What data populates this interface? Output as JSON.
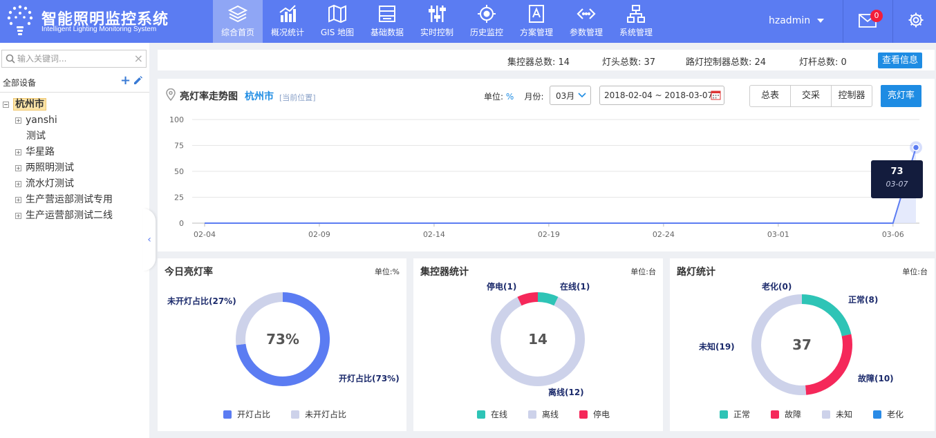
{
  "app": {
    "title": "智能照明监控系统",
    "subtitle": "Intelligent Lighting Monitoring System"
  },
  "nav": [
    {
      "label": "综合首页",
      "icon": "layers-icon",
      "active": true
    },
    {
      "label": "概况统计",
      "icon": "bar-chart-icon",
      "active": false
    },
    {
      "label": "GIS 地图",
      "icon": "map-icon",
      "active": false
    },
    {
      "label": "基础数据",
      "icon": "database-icon",
      "active": false
    },
    {
      "label": "实时控制",
      "icon": "sliders-icon",
      "active": false
    },
    {
      "label": "历史监控",
      "icon": "target-icon",
      "active": false
    },
    {
      "label": "方案管理",
      "icon": "plan-icon",
      "active": false
    },
    {
      "label": "参数管理",
      "icon": "code-icon",
      "active": false
    },
    {
      "label": "系统管理",
      "icon": "sitemap-icon",
      "active": false
    }
  ],
  "user": {
    "name": "hzadmin",
    "mail_count": "0"
  },
  "sidebar": {
    "search_placeholder": "输入关键词...",
    "clear_label": "×",
    "section_title": "全部设备",
    "add_label": "+",
    "tree_root": "杭州市",
    "tree_items": [
      {
        "label": "yanshi",
        "expandable": true
      },
      {
        "label": "测试",
        "expandable": false
      },
      {
        "label": "华星路",
        "expandable": true
      },
      {
        "label": "两照明测试",
        "expandable": true
      },
      {
        "label": "流水灯测试",
        "expandable": true
      },
      {
        "label": "生产营运部测试专用",
        "expandable": true
      },
      {
        "label": "生产运营部测试二线",
        "expandable": true
      }
    ],
    "collapse_label": "‹"
  },
  "stats": {
    "concentrator_total_label": "集控器总数:",
    "concentrator_total": "14",
    "lamp_total_label": "灯头总数:",
    "lamp_total": "37",
    "controller_total_label": "路灯控制器总数:",
    "controller_total": "24",
    "pole_total_label": "灯杆总数:",
    "pole_total": "0",
    "view_button": "查看信息"
  },
  "trend": {
    "title": "亮灯率走势图",
    "city": "杭州市",
    "location_hint": "[当前位置]",
    "unit_label": "单位:",
    "unit_value": "%",
    "month_label": "月份:",
    "month_value": "03月",
    "date_range": "2018-02-04 ~ 2018-03-07",
    "tabs": [
      "总表",
      "交采",
      "控制器",
      "亮灯率"
    ],
    "active_tab": "亮灯率",
    "tooltip_value": "73",
    "tooltip_date": "03-07"
  },
  "chart_data": {
    "type": "line",
    "ylim": [
      0,
      100
    ],
    "yticks": [
      0,
      25,
      50,
      75,
      100
    ],
    "xticks": [
      "02-04",
      "02-09",
      "02-14",
      "02-19",
      "02-24",
      "03-01",
      "03-06"
    ],
    "x": [
      "02-04",
      "02-05",
      "02-06",
      "02-07",
      "02-08",
      "02-09",
      "02-10",
      "02-11",
      "02-12",
      "02-13",
      "02-14",
      "02-15",
      "02-16",
      "02-17",
      "02-18",
      "02-19",
      "02-20",
      "02-21",
      "02-22",
      "02-23",
      "02-24",
      "02-25",
      "02-26",
      "02-27",
      "02-28",
      "03-01",
      "03-02",
      "03-03",
      "03-04",
      "03-05",
      "03-06",
      "03-07"
    ],
    "values": [
      0,
      0,
      0,
      0,
      0,
      0,
      0,
      0,
      0,
      0,
      0,
      0,
      0,
      0,
      0,
      0,
      0,
      0,
      0,
      0,
      0,
      0,
      0,
      0,
      0,
      0,
      0,
      0,
      0,
      0,
      0,
      73
    ],
    "color": "#5b7cf2"
  },
  "panels": {
    "today": {
      "title": "今日亮灯率",
      "unit": "单位:%",
      "center": "73%",
      "slices": [
        {
          "name": "开灯占比",
          "value": 73,
          "color": "#5b7cf2",
          "callout": "开灯占比(73%)"
        },
        {
          "name": "未开灯占比",
          "value": 27,
          "color": "#cdd2ea",
          "callout": "未开灯占比(27%)"
        }
      ]
    },
    "concentrator": {
      "title": "集控器统计",
      "unit": "单位:台",
      "center": "14",
      "slices": [
        {
          "name": "在线",
          "value": 1,
          "color": "#2ec4b6",
          "callout": "在线(1)"
        },
        {
          "name": "离线",
          "value": 12,
          "color": "#cdd2ea",
          "callout": "离线(12)"
        },
        {
          "name": "停电",
          "value": 1,
          "color": "#f5285a",
          "callout": "停电(1)"
        }
      ]
    },
    "streetlight": {
      "title": "路灯统计",
      "unit": "单位:台",
      "center": "37",
      "slices": [
        {
          "name": "正常",
          "value": 8,
          "color": "#2ec4b6",
          "callout": "正常(8)"
        },
        {
          "name": "故障",
          "value": 10,
          "color": "#f5285a",
          "callout": "故障(10)"
        },
        {
          "name": "未知",
          "value": 19,
          "color": "#cdd2ea",
          "callout": "未知(19)"
        },
        {
          "name": "老化",
          "value": 0,
          "color": "#2a8be6",
          "callout": "老化(0)"
        }
      ]
    }
  }
}
